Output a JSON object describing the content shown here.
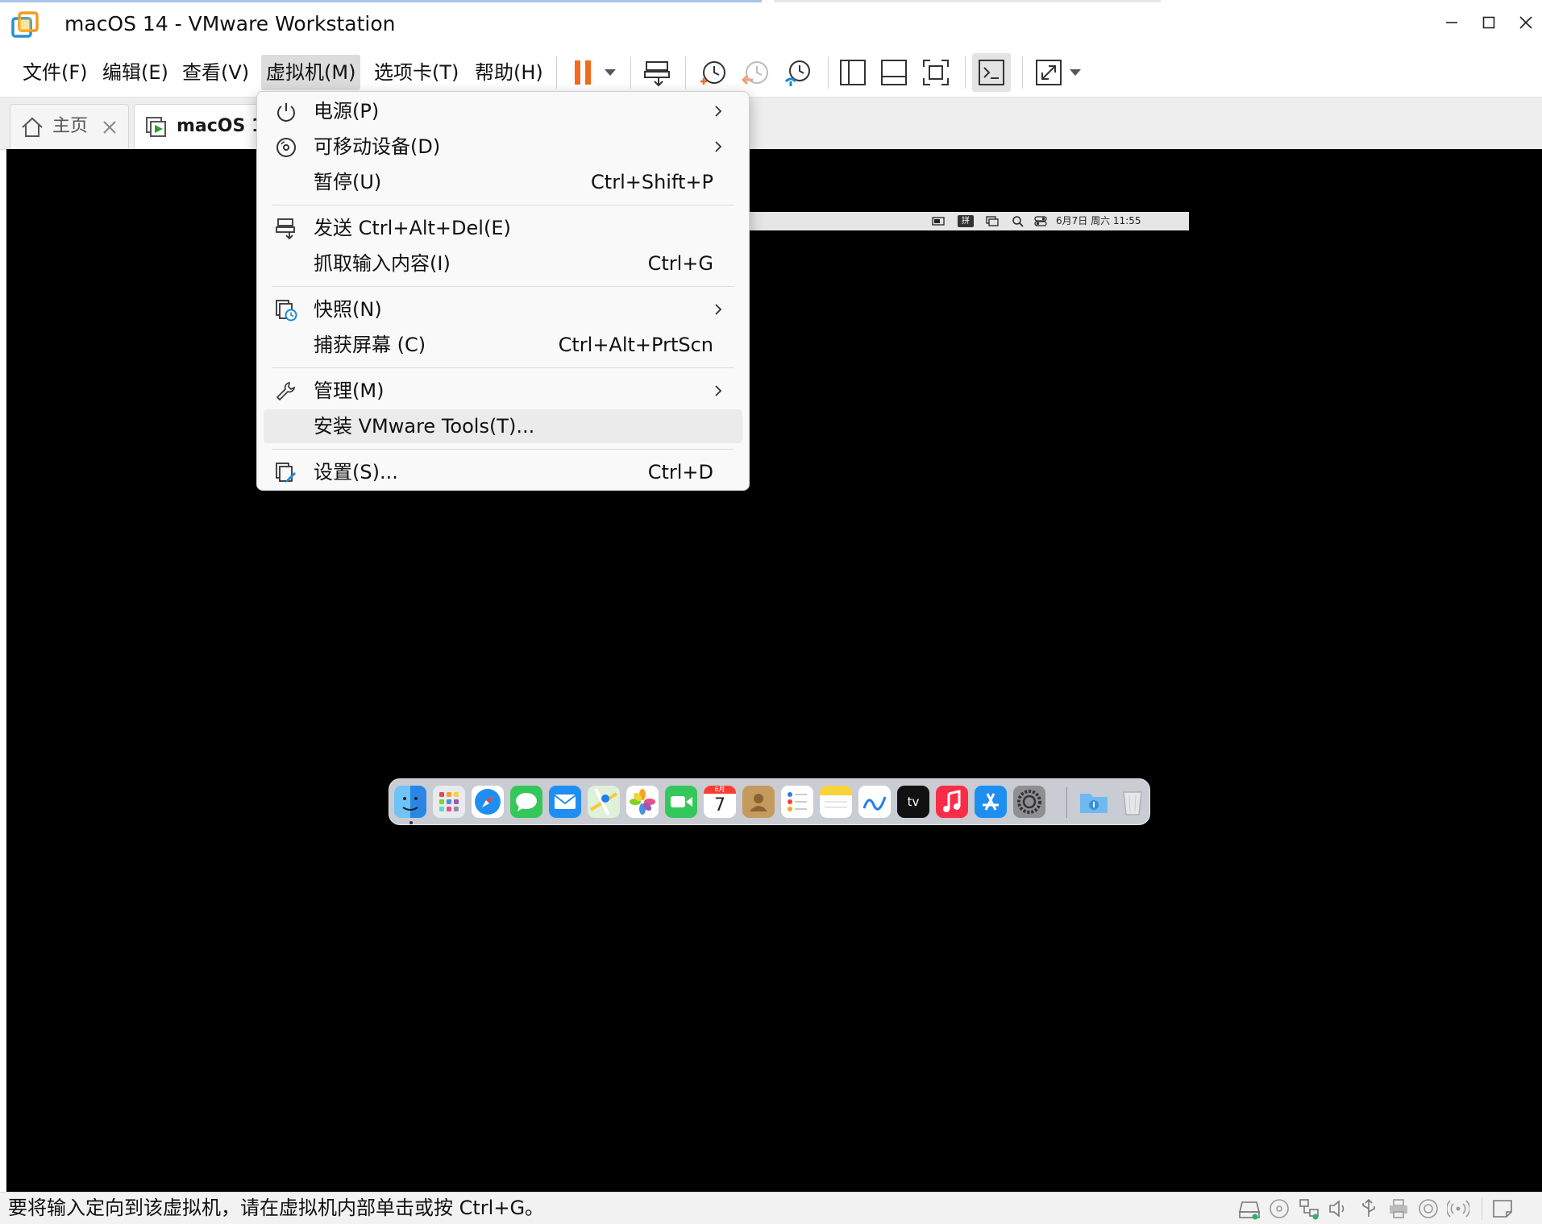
{
  "window": {
    "title": "macOS 14 - VMware Workstation"
  },
  "menubar": {
    "items": [
      {
        "label": "文件(F)"
      },
      {
        "label": "编辑(E)"
      },
      {
        "label": "查看(V)"
      },
      {
        "label": "虚拟机(M)",
        "active": true
      },
      {
        "label": "选项卡(T)"
      },
      {
        "label": "帮助(H)"
      }
    ]
  },
  "toolbar": {
    "icons": [
      "pause-icon",
      "dropdown-icon",
      "send-ctrl-alt-del-icon",
      "snapshot-take-icon",
      "snapshot-revert-icon",
      "snapshot-manager-icon",
      "library-pane-icon",
      "thumbnail-bar-icon",
      "fullscreen-icon",
      "console-view-icon",
      "stretch-guest-icon",
      "dropdown-icon"
    ],
    "accent_color": "#f26b1d"
  },
  "tabs": [
    {
      "label": "主页",
      "icon": "home-icon",
      "active": false
    },
    {
      "label": "macOS 14",
      "icon": "vm-icon",
      "active": true
    }
  ],
  "context_menu": {
    "items": [
      {
        "label": "电源(P)",
        "icon": "power-icon",
        "submenu": true
      },
      {
        "label": "可移动设备(D)",
        "icon": "removable-device-icon",
        "submenu": true
      },
      {
        "label": "暂停(U)",
        "shortcut": "Ctrl+Shift+P"
      },
      {
        "label": "发送 Ctrl+Alt+Del(E)",
        "icon": "send-keys-icon"
      },
      {
        "label": "抓取输入内容(I)",
        "shortcut": "Ctrl+G"
      },
      {
        "label": "快照(N)",
        "icon": "snapshot-icon",
        "submenu": true
      },
      {
        "label": "捕获屏幕 (C)",
        "shortcut": "Ctrl+Alt+PrtScn"
      },
      {
        "label": "管理(M)",
        "icon": "wrench-icon",
        "submenu": true
      },
      {
        "label": "安装 VMware Tools(T)...",
        "hover": true
      },
      {
        "label": "设置(S)...",
        "icon": "settings-icon",
        "shortcut": "Ctrl+D"
      }
    ]
  },
  "guest": {
    "menubar": {
      "input_method": "拼",
      "datetime": "6月7日 周六  11:55"
    },
    "dock": {
      "apps": [
        "finder",
        "launchpad",
        "safari",
        "messages",
        "mail",
        "maps",
        "photos",
        "facetime",
        "calendar",
        "contacts",
        "reminders",
        "notes",
        "freeform",
        "tv",
        "music",
        "app-store",
        "system-settings",
        "downloads",
        "trash"
      ],
      "calendar_day": "7",
      "calendar_month": "6月",
      "tv_label": "tv"
    }
  },
  "statusbar": {
    "text": "要将输入定向到该虚拟机，请在虚拟机内部单击或按 Ctrl+G。",
    "icons": [
      "hdd-icon",
      "cd-icon",
      "network-icon",
      "sound-icon",
      "usb-icon",
      "printer-icon",
      "camera-icon",
      "wireless-icon",
      "message-icon"
    ]
  }
}
